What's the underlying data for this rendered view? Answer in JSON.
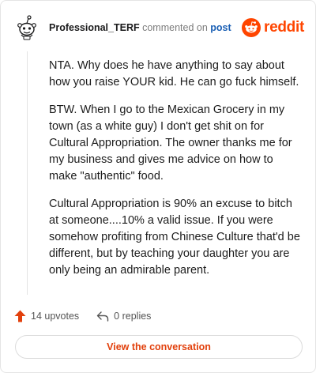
{
  "header": {
    "username": "Professional_TERF",
    "action_text": "commented on",
    "post_link": "post",
    "avatar_icon": "snoo-avatar-icon",
    "brand_icon": "reddit-logo-icon",
    "brand_text": "reddit",
    "brand_color": "#ff4500"
  },
  "comment": {
    "paragraphs": [
      "NTA. Why does he have anything to say about how you raise YOUR kid. He can go fuck himself.",
      "BTW. When I go to the Mexican Grocery in my town (as a white guy) I don't get shit on for Cultural Appropriation. The owner thanks me for my business and gives me advice on how to make \"authentic\" food.",
      "Cultural Appropriation is 90% an excuse to bitch at someone....10% a valid issue. If you were somehow profiting from Chinese Culture that'd be different, but by teaching your daughter you are only being an admirable parent."
    ]
  },
  "footer": {
    "upvotes_icon": "upvote-arrow-icon",
    "upvotes": "14 upvotes",
    "replies_icon": "reply-arrow-icon",
    "replies": "0 replies"
  },
  "cta": {
    "label": "View the conversation",
    "color": "#e2400c"
  }
}
